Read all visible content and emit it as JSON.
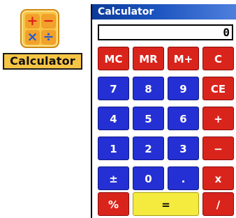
{
  "icon": {
    "ops": [
      "+",
      "−",
      "×",
      "÷"
    ],
    "label": "Calculator"
  },
  "window": {
    "title": "Calculator",
    "display": "0"
  },
  "keys": [
    {
      "label": "MC",
      "color": "red",
      "name": "mc-button"
    },
    {
      "label": "MR",
      "color": "red",
      "name": "mr-button"
    },
    {
      "label": "M+",
      "color": "red",
      "name": "m-plus-button"
    },
    {
      "label": "C",
      "color": "red",
      "name": "clear-button"
    },
    {
      "label": "7",
      "color": "blue",
      "name": "digit-7-button"
    },
    {
      "label": "8",
      "color": "blue",
      "name": "digit-8-button"
    },
    {
      "label": "9",
      "color": "blue",
      "name": "digit-9-button"
    },
    {
      "label": "CE",
      "color": "red",
      "name": "clear-entry-button"
    },
    {
      "label": "4",
      "color": "blue",
      "name": "digit-4-button"
    },
    {
      "label": "5",
      "color": "blue",
      "name": "digit-5-button"
    },
    {
      "label": "6",
      "color": "blue",
      "name": "digit-6-button"
    },
    {
      "label": "+",
      "color": "red",
      "name": "add-button"
    },
    {
      "label": "1",
      "color": "blue",
      "name": "digit-1-button"
    },
    {
      "label": "2",
      "color": "blue",
      "name": "digit-2-button"
    },
    {
      "label": "3",
      "color": "blue",
      "name": "digit-3-button"
    },
    {
      "label": "−",
      "color": "red",
      "name": "subtract-button"
    },
    {
      "label": "±",
      "color": "blue",
      "name": "sign-toggle-button"
    },
    {
      "label": "0",
      "color": "blue",
      "name": "digit-0-button"
    },
    {
      "label": ".",
      "color": "blue",
      "name": "decimal-button"
    },
    {
      "label": "x",
      "color": "red",
      "name": "multiply-button"
    },
    {
      "label": "%",
      "color": "red",
      "name": "percent-button"
    },
    {
      "label": "=",
      "color": "yellow",
      "name": "equals-button",
      "wide": true
    },
    {
      "label": "/",
      "color": "red",
      "name": "divide-button"
    }
  ],
  "colors": {
    "red": "#d9241c",
    "blue": "#2430d3",
    "yellow": "#f5ea3e",
    "title_bar": "#1d55c0",
    "icon_tile": "#f7c545"
  }
}
